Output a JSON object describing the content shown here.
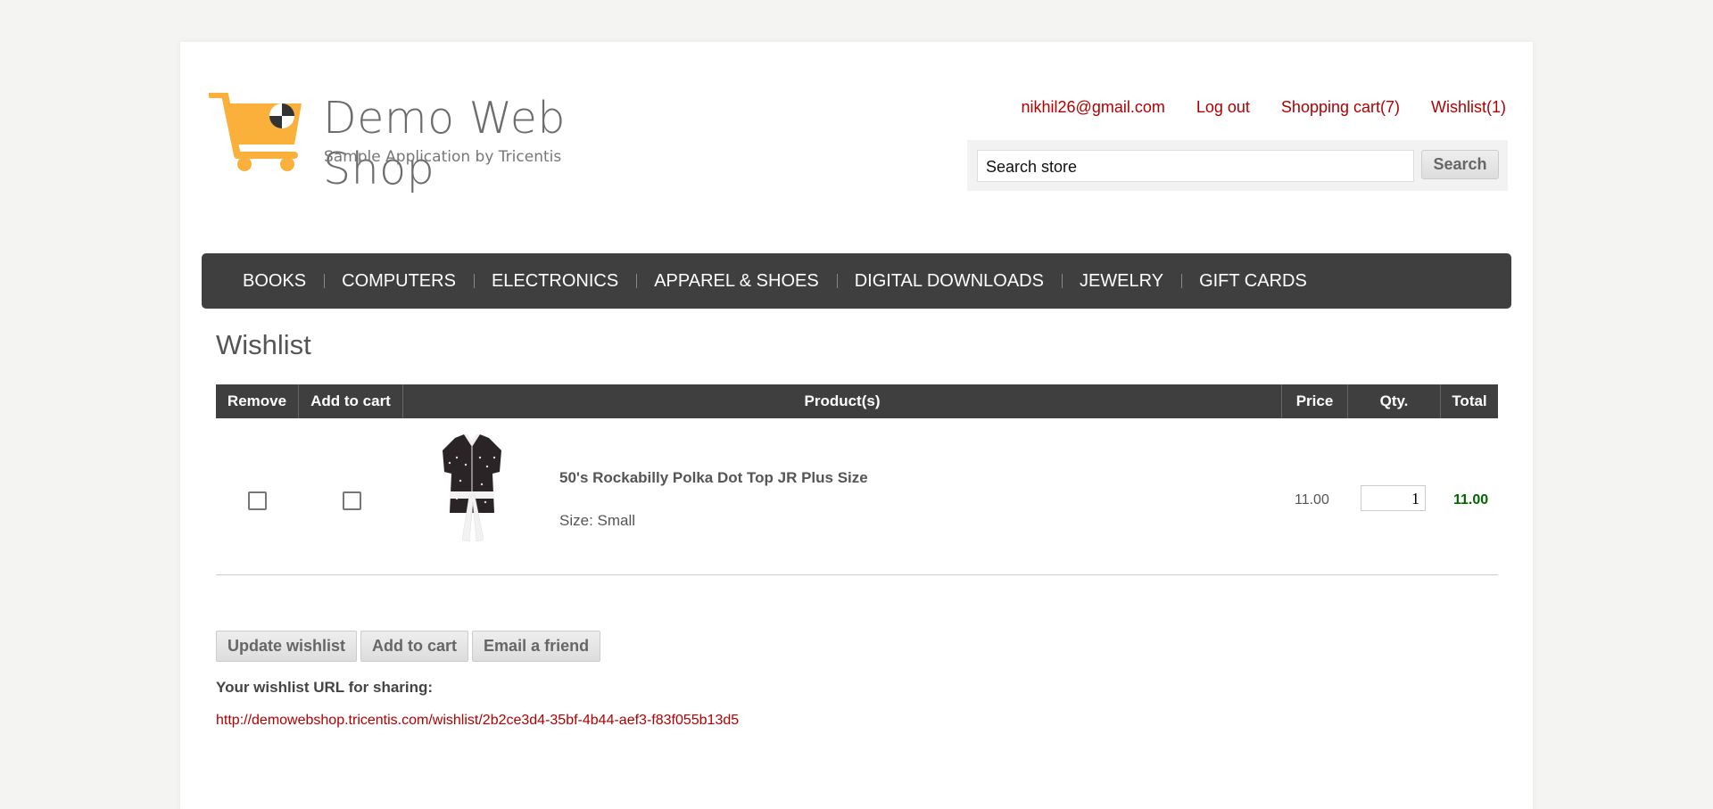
{
  "header": {
    "logo_title": "Demo Web Shop",
    "logo_subtitle": "Sample Application by Tricentis",
    "links": {
      "email": "nikhil26@gmail.com",
      "logout": "Log out",
      "cart": "Shopping cart(7)",
      "wishlist": "Wishlist(1)"
    },
    "search": {
      "value": "Search store",
      "button": "Search"
    }
  },
  "nav": {
    "items": [
      "BOOKS",
      "COMPUTERS",
      "ELECTRONICS",
      "APPAREL & SHOES",
      "DIGITAL DOWNLOADS",
      "JEWELRY",
      "GIFT CARDS"
    ]
  },
  "page": {
    "title": "Wishlist",
    "table": {
      "headers": {
        "remove": "Remove",
        "add_to_cart": "Add to cart",
        "product": "Product(s)",
        "price": "Price",
        "qty": "Qty.",
        "total": "Total"
      },
      "rows": [
        {
          "product_name": "50's Rockabilly Polka Dot Top JR Plus Size",
          "attributes": "Size: Small",
          "price": "11.00",
          "qty": "1",
          "total": "11.00"
        }
      ]
    },
    "buttons": {
      "update": "Update wishlist",
      "add_to_cart": "Add to cart",
      "email": "Email a friend"
    },
    "share_label": "Your wishlist URL for sharing:",
    "share_url": "http://demowebshop.tricentis.com/wishlist/2b2ce3d4-35bf-4b44-aef3-f83f055b13d5"
  },
  "colors": {
    "link": "#b10000",
    "nav_bg": "#3f3f3f",
    "total": "#006600",
    "logo_accent": "#fbb03b"
  },
  "icons": [
    "cart-logo-icon",
    "product-thumbnail"
  ]
}
